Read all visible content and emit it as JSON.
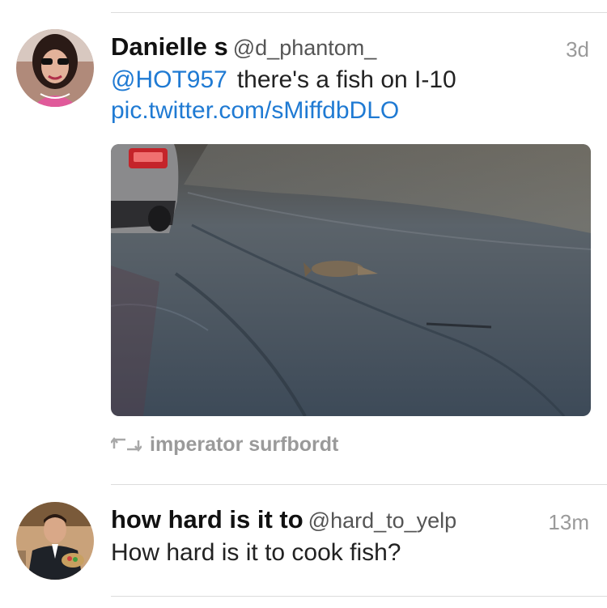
{
  "tweets": [
    {
      "name": "Danielle s",
      "handle": "@d_phantom_",
      "time": "3d",
      "mention": "@HOT957",
      "text": "there's a fish on I-10",
      "link": "pic.twitter.com/sMiffdbDLO",
      "retweeted_by": "imperator surfbordt",
      "avatar_icon": "avatar-woman-sunglasses"
    },
    {
      "name": "how hard is it to",
      "handle": "@hard_to_yelp",
      "time": "13m",
      "text": "How hard is it to cook fish?",
      "avatar_icon": "avatar-man-suit"
    }
  ],
  "icons": {
    "retweet": "retweet-icon"
  },
  "colors": {
    "link": "#1f7ad3",
    "meta": "#9a9a9a",
    "divider": "#dcdcdc"
  }
}
